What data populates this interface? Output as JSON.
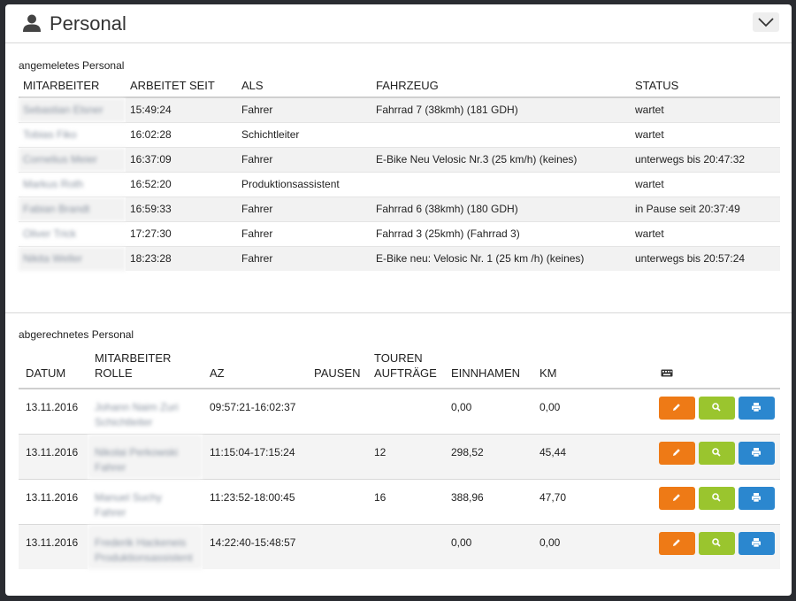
{
  "panel": {
    "title": "Personal"
  },
  "logged_in": {
    "label": "angemeletes Personal",
    "columns": [
      "MITARBEITER",
      "ARBEITET SEIT",
      "ALS",
      "FAHRZEUG",
      "STATUS"
    ],
    "rows": [
      {
        "employee": "Sebastian Elsner",
        "since": "15:49:24",
        "role": "Fahrer",
        "vehicle": "Fahrrad 7 (38kmh) (181 GDH)",
        "status": "wartet"
      },
      {
        "employee": "Tobias Fiko",
        "since": "16:02:28",
        "role": "Schichtleiter",
        "vehicle": "",
        "status": "wartet"
      },
      {
        "employee": "Cornelius Meier",
        "since": "16:37:09",
        "role": "Fahrer",
        "vehicle": "E-Bike Neu Velosic Nr.3 (25 km/h) (keines)",
        "status": "unterwegs bis 20:47:32"
      },
      {
        "employee": "Markus Roth",
        "since": "16:52:20",
        "role": "Produktionsassistent",
        "vehicle": "",
        "status": "wartet"
      },
      {
        "employee": "Fabian Brandt",
        "since": "16:59:33",
        "role": "Fahrer",
        "vehicle": "Fahrrad 6 (38kmh) (180 GDH)",
        "status": "in Pause seit 20:37:49"
      },
      {
        "employee": "Oliver Trick",
        "since": "17:27:30",
        "role": "Fahrer",
        "vehicle": "Fahrrad 3 (25kmh) (Fahrrad 3)",
        "status": "wartet"
      },
      {
        "employee": "Nikita Weller",
        "since": "18:23:28",
        "role": "Fahrer",
        "vehicle": "E-Bike neu: Velosic Nr. 1 (25 km /h) (keines)",
        "status": "unterwegs bis 20:57:24"
      }
    ]
  },
  "settled": {
    "label": "abgerechnetes Personal",
    "columns": {
      "date": "DATUM",
      "employee_line1": "MITARBEITER",
      "employee_line2": "ROLLE",
      "az": "AZ",
      "breaks": "PAUSEN",
      "tours_line1": "TOUREN",
      "tours_line2": "AUFTRÄGE",
      "revenue": "EINNHAMEN",
      "km": "KM"
    },
    "header_icon": "keyboard-icon",
    "rows": [
      {
        "date": "13.11.2016",
        "employee": "Johann Naim Zuri",
        "role": "Schichtleiter",
        "az": "09:57:21-16:02:37",
        "breaks": "",
        "tours": "",
        "revenue": "0,00",
        "km": "0,00"
      },
      {
        "date": "13.11.2016",
        "employee": "Nikolai Perkowski",
        "role": "Fahrer",
        "az": "11:15:04-17:15:24",
        "breaks": "",
        "tours": "12",
        "revenue": "298,52",
        "km": "45,44"
      },
      {
        "date": "13.11.2016",
        "employee": "Manuel Suchy",
        "role": "Fahrer",
        "az": "11:23:52-18:00:45",
        "breaks": "",
        "tours": "16",
        "revenue": "388,96",
        "km": "47,70"
      },
      {
        "date": "13.11.2016",
        "employee": "Frederik Hackeneis",
        "role": "Produktionsassistent",
        "az": "14:22:40-15:48:57",
        "breaks": "",
        "tours": "",
        "revenue": "0,00",
        "km": "0,00"
      }
    ],
    "action_icons": [
      "pencil-icon",
      "magnifier-icon",
      "printer-icon"
    ]
  },
  "colors": {
    "edit": "#ee7a16",
    "view": "#9ac52e",
    "print": "#2b87cf"
  }
}
